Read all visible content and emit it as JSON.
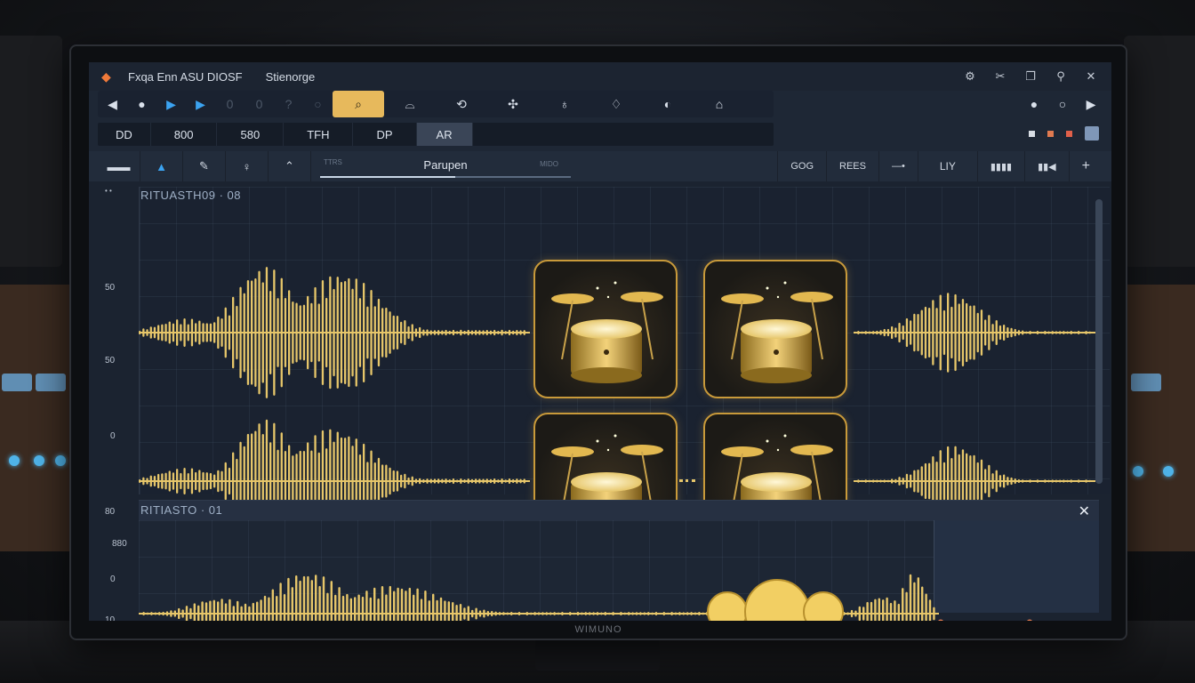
{
  "window": {
    "title": "Fxqa Enn ASU DIOSF",
    "subtitle": "Stienorge",
    "controls": [
      "settings-icon",
      "scissors-icon",
      "copy-icon",
      "pin-icon",
      "close-icon"
    ]
  },
  "transport": {
    "buttons": [
      {
        "name": "rewind",
        "glyph": "◀"
      },
      {
        "name": "record",
        "glyph": "●"
      },
      {
        "name": "play",
        "glyph": "▶"
      },
      {
        "name": "play-next",
        "glyph": "▶"
      },
      {
        "name": "zero-1",
        "glyph": "0"
      },
      {
        "name": "zero-2",
        "glyph": "0"
      },
      {
        "name": "help",
        "glyph": "?"
      },
      {
        "name": "circle",
        "glyph": "○"
      }
    ],
    "tools": [
      "search",
      "dome",
      "lasso",
      "puzzle",
      "drop",
      "shield",
      "apple",
      "house"
    ],
    "right": [
      "●",
      "○",
      "▶"
    ]
  },
  "tabs": [
    "DD",
    "800",
    "580",
    "TFH",
    "DP",
    "AR"
  ],
  "active_tab": "AR",
  "toolbar": {
    "left_tools": [
      "▬▬",
      "▲",
      "✎",
      "♀",
      "⌃"
    ],
    "track_box": {
      "left": "TTRS",
      "center": "Parupen",
      "right": "MIDO"
    },
    "right_tools": [
      "GOG",
      "REES",
      "—•",
      "LIY",
      "▮▮▮▮",
      "▮▮◀",
      "+"
    ]
  },
  "ruler": [
    "50",
    "50",
    "0",
    "80",
    "880",
    "0",
    "10"
  ],
  "lanes": {
    "top_title": "RITUASTH09 · 08",
    "bottom_title": "RITIASTO · 01"
  },
  "monitor_brand": "WIMUNO",
  "colors": {
    "accent": "#e7b95c",
    "waveform": "#e6c66a",
    "play_blue": "#3ba3f0",
    "background": "#1e2735"
  }
}
